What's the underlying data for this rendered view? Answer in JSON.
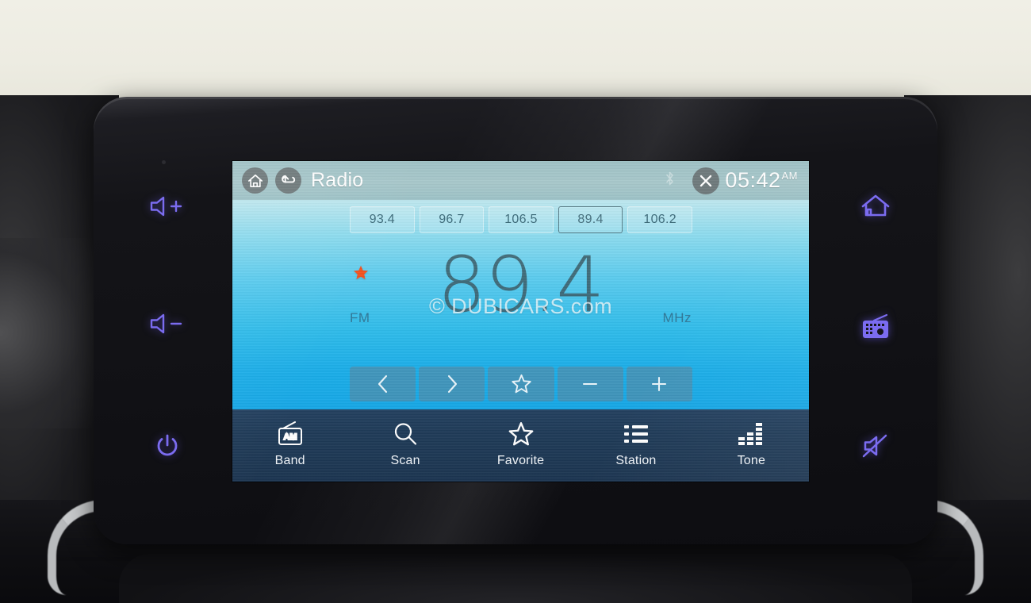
{
  "device": {
    "name": "car-infotainment-head-unit",
    "app_title": "Radio"
  },
  "hardkeys": {
    "left": [
      {
        "name": "volume-up-button",
        "label": "Volume Up",
        "icon": "volume-up-icon"
      },
      {
        "name": "volume-down-button",
        "label": "Volume Down",
        "icon": "volume-down-icon"
      },
      {
        "name": "power-button",
        "label": "Power",
        "icon": "power-icon"
      }
    ],
    "right": [
      {
        "name": "home-button",
        "label": "Home",
        "icon": "home-icon"
      },
      {
        "name": "radio-button",
        "label": "Radio",
        "icon": "radio-icon"
      },
      {
        "name": "mute-button",
        "label": "Mute",
        "icon": "mute-icon"
      }
    ],
    "backlight_color": "#7b6cf0"
  },
  "header": {
    "home_icon": "home-icon",
    "back_icon": "back-arrow-icon",
    "title": "Radio",
    "bluetooth_icon": "bluetooth-icon",
    "close_icon": "close-icon",
    "time": "05:42",
    "meridiem": "AM"
  },
  "presets": [
    {
      "label": "93.4",
      "active": false
    },
    {
      "label": "96.7",
      "active": false
    },
    {
      "label": "106.5",
      "active": false
    },
    {
      "label": "89.4",
      "active": true
    },
    {
      "label": "106.2",
      "active": false
    }
  ],
  "tuner": {
    "frequency": "89.4",
    "band": "FM",
    "unit": "MHz",
    "favorite_marked": true,
    "favorite_icon": "star-filled-icon",
    "favorite_color": "#f4511e"
  },
  "watermark": {
    "text": "© DUBICARS.com"
  },
  "controls": [
    {
      "name": "seek-down-button",
      "label": "Previous",
      "icon": "chevron-left-icon"
    },
    {
      "name": "seek-up-button",
      "label": "Next",
      "icon": "chevron-right-icon"
    },
    {
      "name": "favorite-toggle-button",
      "label": "Favorite",
      "icon": "star-outline-icon"
    },
    {
      "name": "tune-down-button",
      "label": "Tune Down",
      "icon": "minus-icon"
    },
    {
      "name": "tune-up-button",
      "label": "Tune Up",
      "icon": "plus-icon"
    }
  ],
  "navbar": [
    {
      "name": "nav-band",
      "label": "Band",
      "icon": "radio-am-icon",
      "badge": "AM"
    },
    {
      "name": "nav-scan",
      "label": "Scan",
      "icon": "search-icon"
    },
    {
      "name": "nav-favorite",
      "label": "Favorite",
      "icon": "star-outline-icon"
    },
    {
      "name": "nav-station",
      "label": "Station",
      "icon": "list-icon"
    },
    {
      "name": "nav-tone",
      "label": "Tone",
      "icon": "equalizer-icon"
    }
  ],
  "colors": {
    "screen_top": "#bfe8ef",
    "screen_bottom": "#16a7e6",
    "navbar": "#1e3a57",
    "header": "#a8c8cb",
    "accent_star": "#f4511e",
    "key_backlight": "#7b6cf0"
  }
}
